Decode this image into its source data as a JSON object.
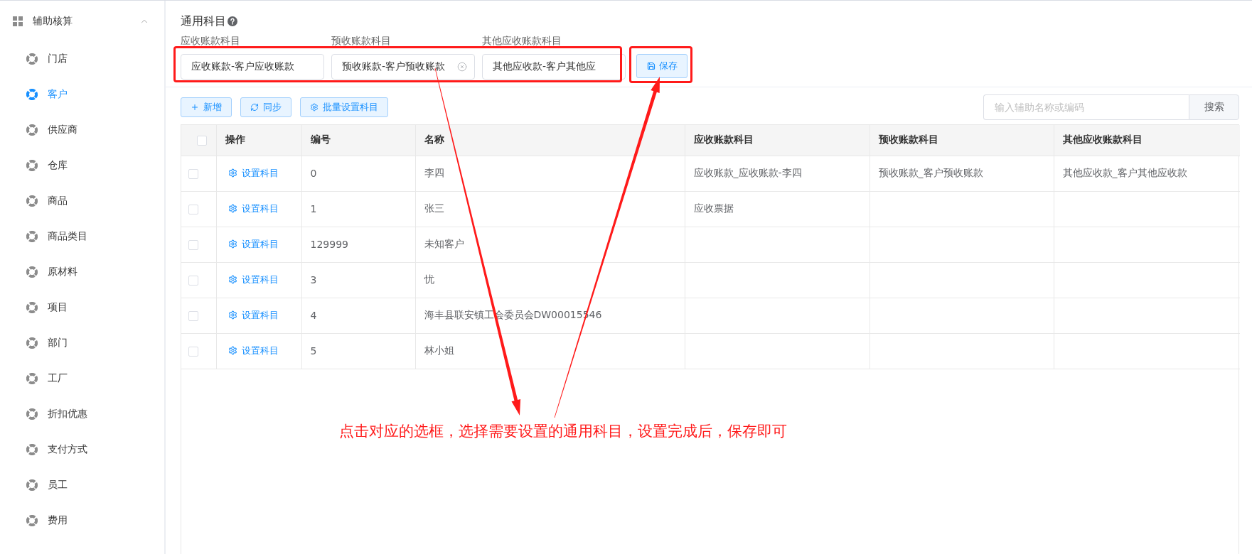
{
  "sidebar": {
    "group": {
      "title": "辅助核算",
      "expanded": true
    },
    "items": [
      {
        "label": "门店",
        "selected": false
      },
      {
        "label": "客户",
        "selected": true
      },
      {
        "label": "供应商",
        "selected": false
      },
      {
        "label": "仓库",
        "selected": false
      },
      {
        "label": "商品",
        "selected": false
      },
      {
        "label": "商品类目",
        "selected": false
      },
      {
        "label": "原材料",
        "selected": false
      },
      {
        "label": "项目",
        "selected": false
      },
      {
        "label": "部门",
        "selected": false
      },
      {
        "label": "工厂",
        "selected": false
      },
      {
        "label": "折扣优惠",
        "selected": false
      },
      {
        "label": "支付方式",
        "selected": false
      },
      {
        "label": "员工",
        "selected": false
      },
      {
        "label": "费用",
        "selected": false
      }
    ]
  },
  "general_accounts": {
    "title": "通用科目",
    "fields": [
      {
        "label": "应收账款科目",
        "value": "应收账款-客户应收账款",
        "show_clear": false
      },
      {
        "label": "预收账款科目",
        "value": "预收账款-客户预收账款",
        "show_clear": true
      },
      {
        "label": "其他应收账款科目",
        "value": "其他应收款-客户其他应",
        "show_clear": false
      }
    ],
    "save_button": "保存"
  },
  "toolbar": {
    "buttons": [
      {
        "kind": "add",
        "label": "新增"
      },
      {
        "kind": "sync",
        "label": "同步"
      },
      {
        "kind": "settings",
        "label": "批量设置科目"
      }
    ],
    "search": {
      "placeholder": "输入辅助名称或编码",
      "button": "搜索"
    }
  },
  "table": {
    "all_checked": false,
    "columns": [
      "操作",
      "编号",
      "名称",
      "应收账款科目",
      "预收账款科目",
      "其他应收账款科目"
    ],
    "rows": [
      {
        "checked": false,
        "action": "设置科目",
        "code": "0",
        "name": "李四",
        "receivable_account": "应收账款_应收账款-李四",
        "advance_account": "预收账款_客户预收账款",
        "other_account": "其他应收款_客户其他应收款"
      },
      {
        "checked": false,
        "action": "设置科目",
        "code": "1",
        "name": "张三",
        "receivable_account": "应收票据"
      },
      {
        "checked": false,
        "action": "设置科目",
        "code": "129999",
        "name": "未知客户"
      },
      {
        "checked": false,
        "action": "设置科目",
        "code": "3",
        "name": "忧"
      },
      {
        "checked": false,
        "action": "设置科目",
        "code": "4",
        "name": "海丰县联安镇工会委员会DW00015546"
      },
      {
        "checked": false,
        "action": "设置科目",
        "code": "5",
        "name": "林小姐"
      }
    ]
  },
  "annotation": {
    "note": "点击对应的选框，选择需要设置的通用科目，设置完成后，保存即可"
  }
}
